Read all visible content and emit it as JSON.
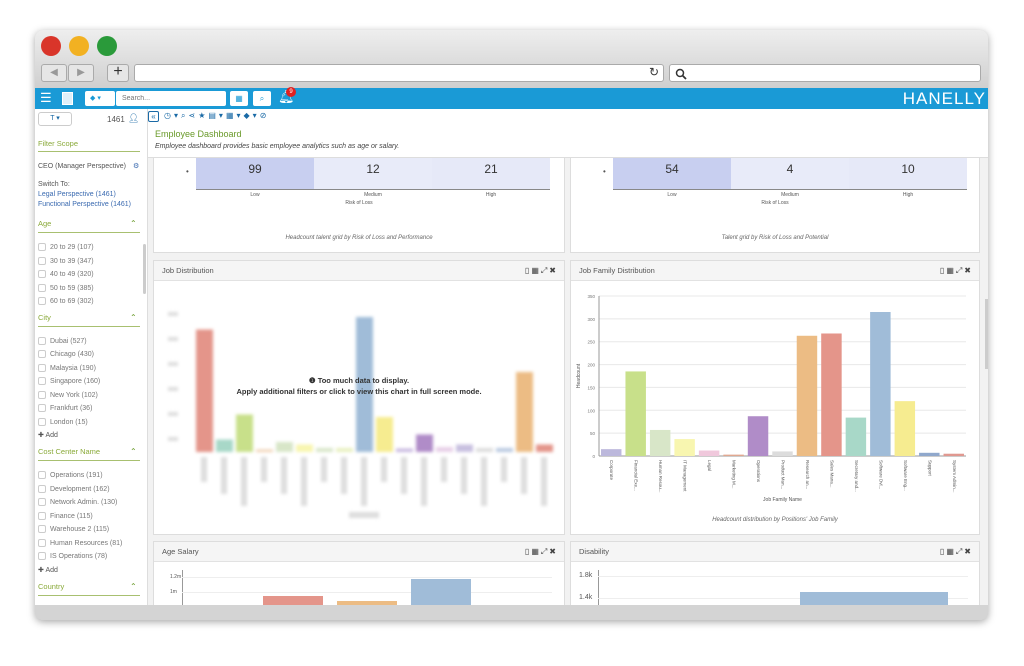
{
  "browser": {
    "back": "◀",
    "forward": "▶",
    "new_tab": "+",
    "reload": "↻",
    "search_icon": "search-icon"
  },
  "app": {
    "search_placeholder": "Search...",
    "notifications": "9",
    "brand": "HANELLY"
  },
  "sidebar": {
    "filter_label": "T ▾",
    "count": "1461",
    "filter_scope": "Filter Scope",
    "perspective": "CEO (Manager Perspective)",
    "switch_to": "Switch To:",
    "links": [
      "Legal Perspective (1461)",
      "Functional Perspective (1461)"
    ],
    "sections": [
      {
        "title": "Age",
        "items": [
          "20 to 29  (107)",
          "30 to 39  (347)",
          "40 to 49  (320)",
          "50 to 59  (385)",
          "60 to 69  (302)"
        ]
      },
      {
        "title": "City",
        "items": [
          "Dubai  (527)",
          "Chicago  (430)",
          "Malaysia  (190)",
          "Singapore  (160)",
          "New York  (102)",
          "Frankfurt  (36)",
          "London  (15)"
        ],
        "add": "Add"
      },
      {
        "title": "Cost Center Name",
        "items": [
          "Operations  (191)",
          "Development  (162)",
          "Network Admin.  (130)",
          "Finance  (115)",
          "Warehouse 2  (115)",
          "Human Resources  (81)",
          "IS Operations  (78)"
        ],
        "add": "Add"
      },
      {
        "title": "Country",
        "items": []
      }
    ]
  },
  "header": {
    "title": "Employee Dashboard",
    "subtitle": "Employee dashboard provides basic employee analytics such as age or salary."
  },
  "panels": {
    "grid1": {
      "values": [
        "99",
        "12",
        "21"
      ],
      "cols": [
        "Low",
        "Medium",
        "High"
      ],
      "xlabel": "Risk of Loss",
      "caption": "Headcount talent grid by Risk of Loss and Performance"
    },
    "grid2": {
      "values": [
        "54",
        "4",
        "10"
      ],
      "cols": [
        "Low",
        "Medium",
        "High"
      ],
      "xlabel": "Risk of Loss",
      "caption": "Talent grid by Risk of Loss and Potential"
    },
    "job_distribution": {
      "title": "Job Distribution",
      "msg1": "❶ Too much data to display.",
      "msg2": "Apply additional filters or click to view this chart in full screen mode."
    },
    "job_family": {
      "title": "Job Family Distribution",
      "caption": "Headcount distribution by Positions' Job Family"
    },
    "age_salary": {
      "title": "Age Salary",
      "ticks": [
        "1.2m",
        "1m"
      ]
    },
    "disability": {
      "title": "Disability",
      "ticks": [
        "1.8k",
        "1.4k"
      ]
    }
  },
  "chart_data": {
    "type": "bar",
    "title": "",
    "xlabel": "Job Family Name",
    "ylabel": "Headcount",
    "ylim": [
      0,
      350
    ],
    "yticks": [
      0,
      50,
      100,
      150,
      200,
      250,
      300,
      350
    ],
    "grid": true,
    "categories": [
      "Corporate",
      "Financial Exe...",
      "Human Resou...",
      "IT Management",
      "Legal",
      "Marketing M...",
      "Operations",
      "Product Man...",
      "Research an...",
      "Sales Mana...",
      "Secretary and...",
      "Software Dvl...",
      "Software Eng...",
      "Support",
      "System Admin..."
    ],
    "values": [
      15,
      185,
      57,
      37,
      12,
      3,
      87,
      10,
      263,
      268,
      84,
      315,
      120,
      7,
      5
    ],
    "colors": [
      "#bcb8dc",
      "#c8e08a",
      "#d8e6c8",
      "#f8f6b0",
      "#f0c8dc",
      "#e0a890",
      "#b08cc8",
      "#dcdcdc",
      "#ecbc84",
      "#e4958a",
      "#a8d8c8",
      "#a0bcd8",
      "#f6ec90",
      "#90a8cc",
      "#e09890"
    ]
  },
  "colors": {
    "appbar": "#1a9ad6",
    "accent": "#8aaa3a",
    "link": "#3a6ab0"
  }
}
